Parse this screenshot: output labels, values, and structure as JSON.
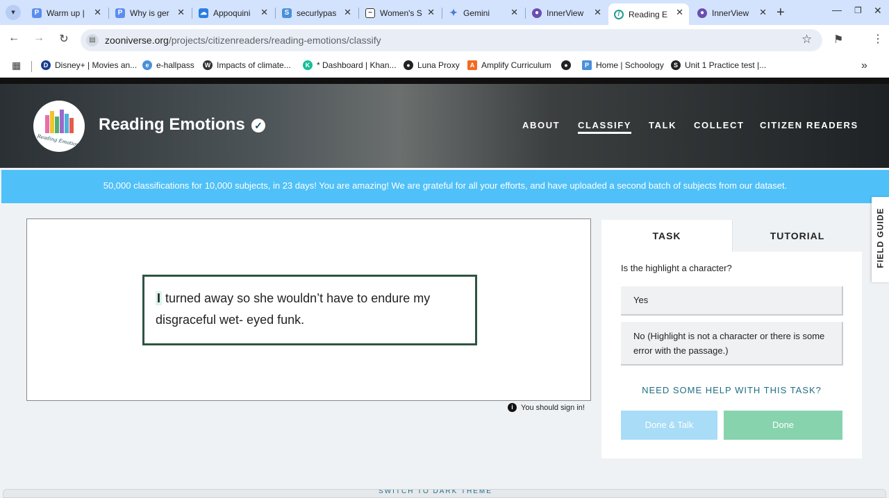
{
  "browser": {
    "tabs": [
      {
        "title": "Warm up |",
        "icon": "p-icon",
        "color": "#5b8def"
      },
      {
        "title": "Why is ger",
        "icon": "p-icon",
        "color": "#5b8def"
      },
      {
        "title": "Appoquini",
        "icon": "cloud-icon",
        "color": "#2a7de1"
      },
      {
        "title": "securlypas",
        "icon": "securly-icon",
        "color": "#4a90d9"
      },
      {
        "title": "Women's S",
        "icon": "wave-icon",
        "color": "#333333"
      },
      {
        "title": "Gemini",
        "icon": "gemini-icon",
        "color": "#4a7bd9"
      },
      {
        "title": "InnerView",
        "icon": "innerview-icon",
        "color": "#6b4fb0"
      },
      {
        "title": "Reading E",
        "icon": "zooniverse-icon",
        "color": "#1f9c8f"
      },
      {
        "title": "InnerView",
        "icon": "innerview-icon",
        "color": "#6b4fb0"
      }
    ],
    "url_host": "zooniverse.org",
    "url_path": "/projects/citizenreaders/reading-emotions/classify",
    "bookmarks": [
      {
        "label": "Disney+ | Movies an...",
        "color": "#1a3d8f"
      },
      {
        "label": "e-hallpass",
        "color": "#4a90d9"
      },
      {
        "label": "Impacts of climate...",
        "color": "#333333"
      },
      {
        "label": "* Dashboard | Khan...",
        "color": "#14bf96"
      },
      {
        "label": "Luna Proxy",
        "color": "#222222"
      },
      {
        "label": "Amplify Curriculum",
        "color": "#f26b21"
      },
      {
        "label": "",
        "color": "#222222"
      },
      {
        "label": "Home | Schoology",
        "color": "#4a90d9"
      },
      {
        "label": "Unit 1 Practice test |...",
        "color": "#222222"
      }
    ]
  },
  "project": {
    "title": "Reading Emotions",
    "logo_text": "Reading Emotions",
    "nav": [
      "ABOUT",
      "CLASSIFY",
      "TALK",
      "COLLECT",
      "CITIZEN READERS"
    ],
    "active_nav": "CLASSIFY"
  },
  "banner": "50,000 classifications for 10,000 subjects, in 23 days! You are amazing! We are grateful for all your efforts, and have uploaded a second batch of subjects from our dataset.",
  "subject": {
    "highlight": "I",
    "text": " turned away so she wouldn’t have to endure my disgraceful wet- eyed funk."
  },
  "signin_note": "You should sign in!",
  "task": {
    "tabs": [
      "TASK",
      "TUTORIAL"
    ],
    "question": "Is the highlight a character?",
    "answers": [
      "Yes",
      "No (Highlight is not a character or there is some error with the passage.)"
    ],
    "help": "NEED SOME HELP WITH THIS TASK?",
    "done_talk": "Done & Talk",
    "done": "Done"
  },
  "field_guide": "FIELD GUIDE",
  "bottom_text": "SWITCH TO DARK THEME"
}
